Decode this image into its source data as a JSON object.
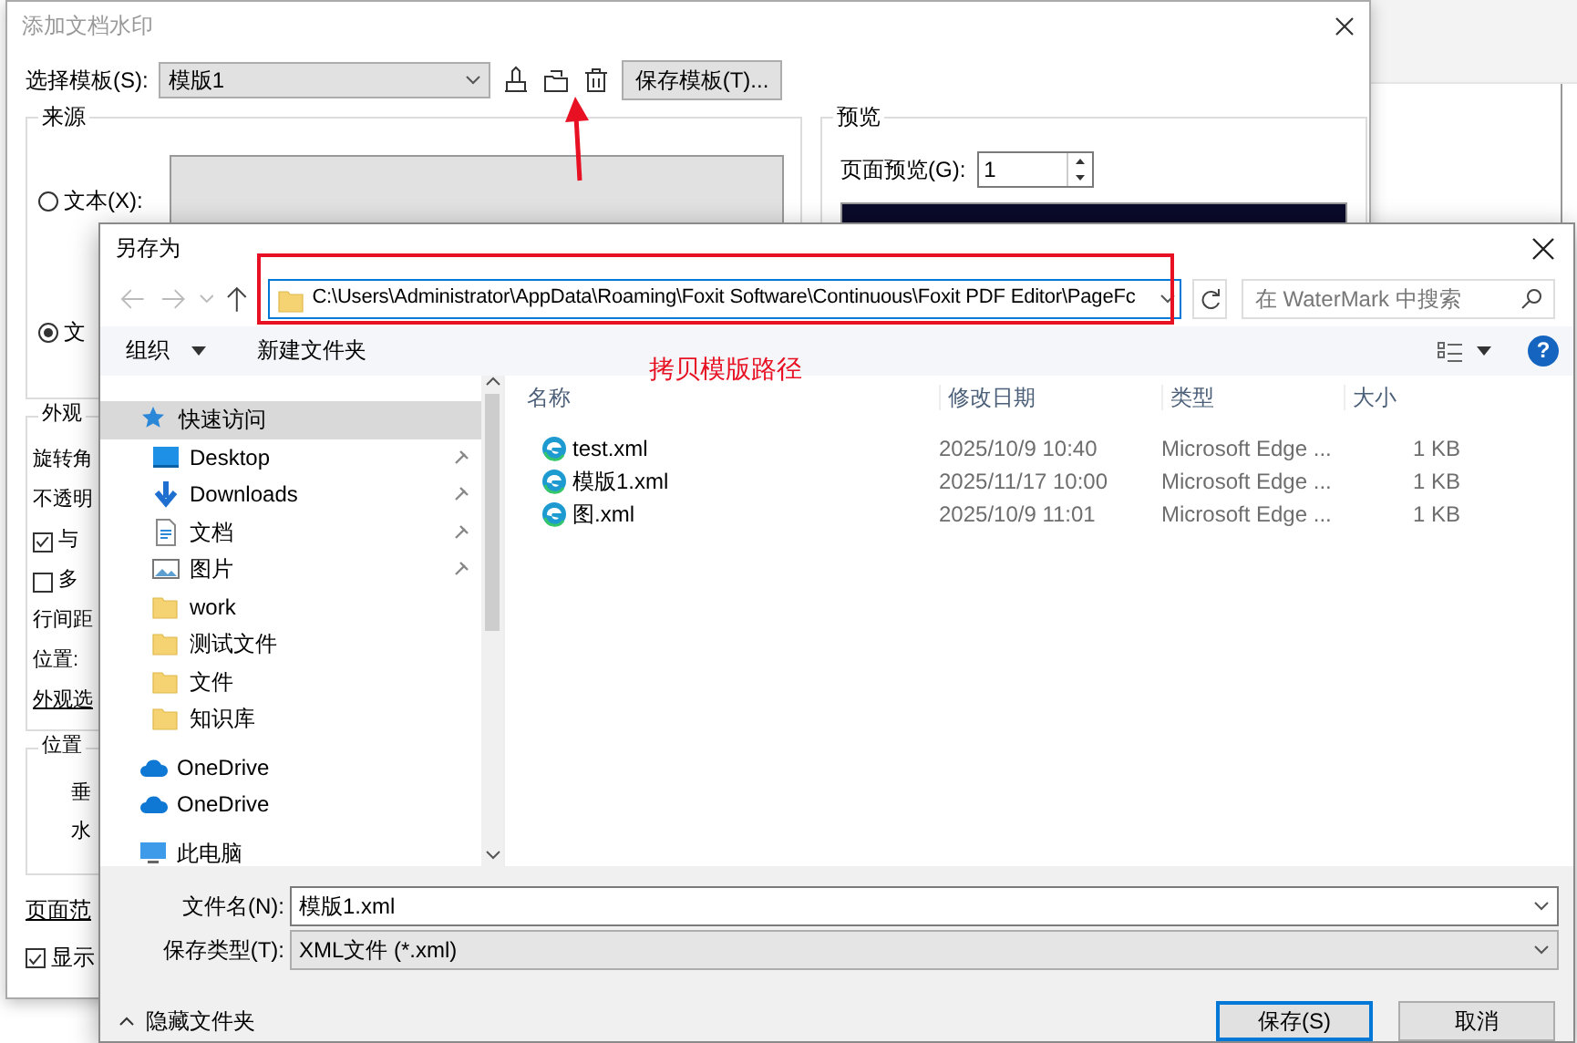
{
  "background_dialog": {
    "title": "添加文档水印",
    "template_label": "选择模板(S):",
    "template_value": "模版1",
    "save_template_button": "保存模板(T)...",
    "source_group": {
      "title": "来源",
      "options": [
        {
          "label": "文本(X):",
          "selected": false
        },
        {
          "label": "文",
          "selected": true
        }
      ]
    },
    "appearance_group": {
      "title": "外观",
      "items": [
        {
          "kind": "label",
          "text": "旋转角"
        },
        {
          "kind": "label",
          "text": "不透明"
        },
        {
          "kind": "checkbox",
          "text": "与",
          "checked": true
        },
        {
          "kind": "checkbox",
          "text": "多",
          "checked": false
        },
        {
          "kind": "label",
          "text": "行间距"
        },
        {
          "kind": "label",
          "text": "位置:"
        },
        {
          "kind": "link",
          "text": "外观选"
        }
      ]
    },
    "position_group": {
      "title": "位置",
      "labels": [
        "垂",
        "水"
      ]
    },
    "page_range_link": "页面范",
    "show_checkbox": {
      "text": "显示",
      "checked": true
    },
    "preview_group": {
      "title": "预览",
      "page_label": "页面预览(G):",
      "page_value": "1"
    }
  },
  "save_dialog": {
    "title": "另存为",
    "path": "C:\\Users\\Administrator\\AppData\\Roaming\\Foxit Software\\Continuous\\Foxit PDF Editor\\PageFc",
    "search_placeholder": "在 WaterMark 中搜索",
    "toolbar": {
      "organize": "组织",
      "new_folder": "新建文件夹",
      "help": "?"
    },
    "nav_items": [
      {
        "kind": "quick",
        "label": "快速访问",
        "selected": true,
        "pinned": false
      },
      {
        "kind": "desktop",
        "label": "Desktop",
        "selected": false,
        "pinned": true
      },
      {
        "kind": "downloads",
        "label": "Downloads",
        "selected": false,
        "pinned": true
      },
      {
        "kind": "documents",
        "label": "文档",
        "selected": false,
        "pinned": true
      },
      {
        "kind": "pictures",
        "label": "图片",
        "selected": false,
        "pinned": true
      },
      {
        "kind": "folder",
        "label": "work",
        "selected": false,
        "pinned": false
      },
      {
        "kind": "folder",
        "label": "测试文件",
        "selected": false,
        "pinned": false
      },
      {
        "kind": "folder",
        "label": "文件",
        "selected": false,
        "pinned": false
      },
      {
        "kind": "folder",
        "label": "知识库",
        "selected": false,
        "pinned": false
      },
      {
        "kind": "onedrive",
        "label": "OneDrive",
        "selected": false,
        "pinned": false
      },
      {
        "kind": "onedrive",
        "label": "OneDrive",
        "selected": false,
        "pinned": false
      },
      {
        "kind": "pc",
        "label": "此电脑",
        "selected": false,
        "pinned": false
      }
    ],
    "columns": [
      "名称",
      "修改日期",
      "类型",
      "大小"
    ],
    "files": [
      {
        "name": "test.xml",
        "date": "2025/10/9 10:40",
        "type": "Microsoft Edge ...",
        "size": "1 KB"
      },
      {
        "name": "模版1.xml",
        "date": "2025/11/17 10:00",
        "type": "Microsoft Edge ...",
        "size": "1 KB"
      },
      {
        "name": "图.xml",
        "date": "2025/10/9 11:01",
        "type": "Microsoft Edge ...",
        "size": "1 KB"
      }
    ],
    "filename_label": "文件名(N):",
    "filename_value": "模版1.xml",
    "filetype_label": "保存类型(T):",
    "filetype_value": "XML文件 (*.xml)",
    "hide_folders": "隐藏文件夹",
    "save_button": "保存(S)",
    "cancel_button": "取消"
  },
  "annotation": {
    "text": "拷贝模版路径"
  }
}
